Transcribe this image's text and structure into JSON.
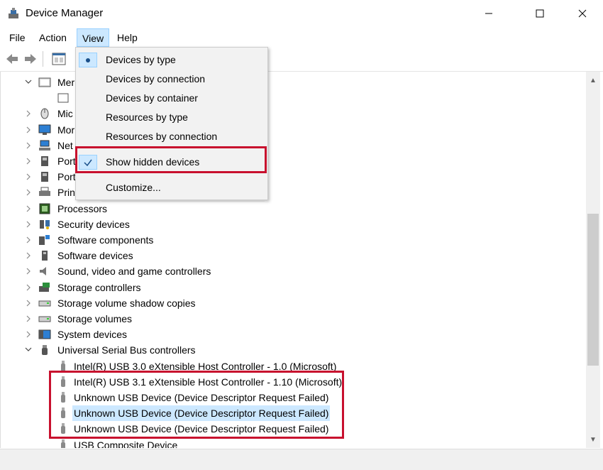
{
  "window": {
    "title": "Device Manager"
  },
  "menubar": {
    "file": "File",
    "action": "Action",
    "view": "View",
    "help": "Help"
  },
  "view_menu": {
    "items": [
      {
        "label": "Devices by type",
        "mark": "bullet"
      },
      {
        "label": "Devices by connection",
        "mark": ""
      },
      {
        "label": "Devices by container",
        "mark": ""
      },
      {
        "label": "Resources by type",
        "mark": ""
      },
      {
        "label": "Resources by connection",
        "mark": ""
      },
      {
        "label": "Show hidden devices",
        "mark": "check"
      },
      {
        "label": "Customize...",
        "mark": ""
      }
    ]
  },
  "tree": {
    "categories": [
      {
        "label": "Mer",
        "expanded": true,
        "icon": "memory-icon"
      },
      {
        "label": "",
        "child": true,
        "icon": "device-icon"
      },
      {
        "label": "Mic",
        "icon": "mouse-icon"
      },
      {
        "label": "Mor",
        "icon": "monitor-icon"
      },
      {
        "label": "Net",
        "icon": "network-icon"
      },
      {
        "label": "Port",
        "icon": "port-icon"
      },
      {
        "label": "Port",
        "icon": "port-icon"
      },
      {
        "label": "Prin",
        "icon": "printer-icon"
      },
      {
        "label": "Processors",
        "icon": "processor-icon"
      },
      {
        "label": "Security devices",
        "icon": "security-icon"
      },
      {
        "label": "Software components",
        "icon": "software-component-icon"
      },
      {
        "label": "Software devices",
        "icon": "software-device-icon"
      },
      {
        "label": "Sound, video and game controllers",
        "icon": "speaker-icon"
      },
      {
        "label": "Storage controllers",
        "icon": "storage-controller-icon"
      },
      {
        "label": "Storage volume shadow copies",
        "icon": "drive-icon"
      },
      {
        "label": "Storage volumes",
        "icon": "drive-icon"
      },
      {
        "label": "System devices",
        "icon": "system-icon"
      },
      {
        "label": "Universal Serial Bus controllers",
        "expanded": true,
        "icon": "usb-icon"
      }
    ],
    "usb_children": [
      "Intel(R) USB 3.0 eXtensible Host Controller - 1.0 (Microsoft)",
      "Intel(R) USB 3.1 eXtensible Host Controller - 1.10 (Microsoft)",
      "Unknown USB Device (Device Descriptor Request Failed)",
      "Unknown USB Device (Device Descriptor Request Failed)",
      "Unknown USB Device (Device Descriptor Request Failed)",
      "USB Composite Device"
    ]
  },
  "colors": {
    "highlight_box": "#c8102e",
    "selection": "#cce8ff"
  }
}
